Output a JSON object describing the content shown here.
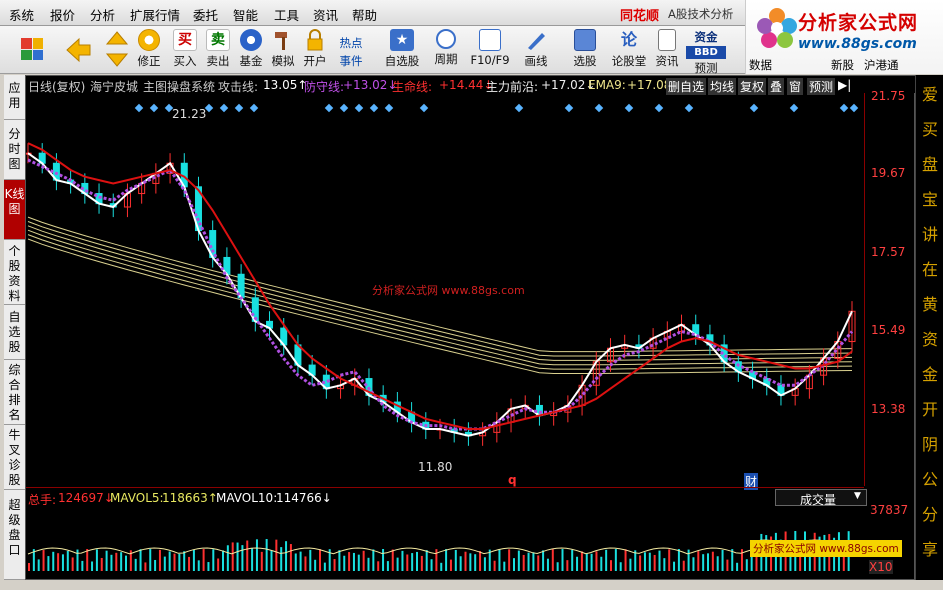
{
  "menu": {
    "items": [
      "系统",
      "报价",
      "分析",
      "扩展行情",
      "委托",
      "智能",
      "工具",
      "资讯",
      "帮助"
    ],
    "brand": "同花顺",
    "brand_tail": "A股技术分析"
  },
  "toolbar": {
    "buttons": [
      {
        "label": "修正",
        "icon": "refresh-icon"
      },
      {
        "label": "买入",
        "glyph": "买",
        "color": "#cc0000"
      },
      {
        "label": "卖出",
        "glyph": "卖",
        "color": "#007700"
      },
      {
        "label": "基金",
        "icon": "fund-icon"
      },
      {
        "label": "模拟",
        "icon": "hammer-icon"
      },
      {
        "label": "开户",
        "icon": "lock-icon"
      },
      {
        "label": "事件",
        "top": "热点"
      },
      {
        "label": "自选股",
        "icon": "star-icon"
      },
      {
        "label": "周期",
        "icon": "clock-icon"
      },
      {
        "label": "F10/F9",
        "icon": "f10-icon"
      },
      {
        "label": "画线",
        "icon": "pen-icon"
      },
      {
        "label": "选股",
        "icon": "select-icon"
      },
      {
        "label": "论股堂",
        "glyph": "论"
      },
      {
        "label": "资讯",
        "icon": "news-icon"
      },
      {
        "label": "预测",
        "top": "资金",
        "mid": "BBD"
      },
      {
        "label": "数据"
      },
      {
        "label": "新股"
      },
      {
        "label": "沪港通"
      }
    ]
  },
  "logo": {
    "title": "分析家公式网",
    "url": "www.88gs.com"
  },
  "sidebar": {
    "items": [
      "应用",
      "分时图",
      "K线图",
      "个股资料",
      "自选股",
      "综合排名",
      "牛叉诊股",
      "超级盘口"
    ],
    "active": 2
  },
  "info": {
    "period": "日线(复权)",
    "stock": "海宁皮城",
    "system": "主图操盘系统",
    "attack_label": "攻击线:",
    "attack": "13.05↑",
    "defend_label": "防守线:",
    "defend": "+13.02↓",
    "life_label": "生命线:",
    "life": "+14.44↓",
    "front_label": "主力前沿:",
    "front": "+17.02↓",
    "ema_label": "EMA9:",
    "ema": "+17.08",
    "buttons": [
      "删自选",
      "均线",
      "复权",
      "叠",
      "窗",
      "预测"
    ]
  },
  "chart_data": {
    "type": "line",
    "ylim": [
      11.0,
      22.0
    ],
    "yticks": [
      "21.75",
      "19.67",
      "17.57",
      "15.49",
      "13.38"
    ],
    "hi_label": "21.23",
    "lo_label": "11.80",
    "watermark": "分析家公式网 www.88gs.com",
    "markers": [
      "q",
      "财"
    ],
    "series": [
      {
        "color": "#ffffff",
        "values": [
          20.3,
          20.0,
          19.5,
          19.4,
          19.1,
          18.8,
          18.7,
          19.1,
          19.4,
          19.7,
          20.0,
          19.3,
          18.0,
          17.2,
          16.7,
          16.0,
          15.3,
          15.1,
          14.6,
          14.0,
          13.7,
          13.3,
          13.4,
          13.6,
          13.1,
          12.9,
          12.6,
          12.3,
          12.1,
          12.1,
          12.0,
          11.9,
          12.0,
          12.3,
          12.7,
          12.8,
          12.5,
          12.6,
          12.8,
          13.4,
          14.1,
          14.5,
          14.6,
          14.5,
          14.8,
          15.0,
          15.2,
          14.9,
          14.6,
          14.1,
          13.8,
          13.6,
          13.4,
          13.1,
          13.3,
          13.7,
          14.2,
          14.7,
          15.6
        ]
      },
      {
        "color": "#b050e0",
        "values": [
          20.1,
          19.9,
          19.7,
          19.5,
          19.2,
          19.0,
          18.9,
          19.2,
          19.4,
          19.6,
          19.8,
          19.2,
          18.3,
          17.4,
          16.6,
          16.0,
          15.4,
          14.8,
          14.2,
          13.7,
          13.4,
          13.5,
          13.7,
          13.8,
          13.3,
          12.8,
          12.5,
          12.3,
          12.2,
          12.2,
          12.1,
          12.1,
          12.1,
          12.3,
          12.5,
          12.7,
          12.6,
          12.6,
          12.7,
          13.1,
          13.6,
          14.0,
          14.3,
          14.4,
          14.6,
          14.8,
          15.0,
          14.9,
          14.7,
          14.3,
          14.0,
          13.8,
          13.6,
          13.4,
          13.4,
          13.7,
          14.0,
          14.5,
          15.0
        ]
      },
      {
        "color": "#dd1111",
        "values": [
          20.6,
          20.4,
          20.1,
          19.8,
          19.6,
          19.5,
          19.4,
          19.5,
          19.6,
          19.7,
          19.8,
          19.6,
          19.2,
          18.6,
          17.9,
          17.2,
          16.5,
          15.8,
          15.2,
          14.6,
          14.2,
          13.9,
          13.6,
          13.4,
          13.2,
          13.0,
          12.8,
          12.6,
          12.4,
          12.3,
          12.2,
          12.1,
          12.1,
          12.2,
          12.3,
          12.4,
          12.5,
          12.6,
          12.7,
          12.8,
          13.0,
          13.3,
          13.6,
          13.9,
          14.2,
          14.5,
          14.7,
          14.8,
          14.7,
          14.5,
          14.3,
          14.2,
          14.1,
          14.0,
          13.9,
          13.9,
          14.0,
          14.1,
          14.4
        ]
      }
    ]
  },
  "volume": {
    "total_label": "总手:",
    "total": "124697↓",
    "mavol5_label": "MAVOL5:",
    "mavol5": "118663↑",
    "mavol10_label": "MAVOL10:",
    "mavol10": "114766↓",
    "selector": "成交量",
    "top_tick": "37837",
    "unit": "X10",
    "badge": "分析家公式网 www.88gs.com"
  },
  "rightpanel": {
    "chars": [
      "爱",
      "买",
      "盘",
      "宝",
      "讲",
      "在",
      "黄",
      "资",
      "金",
      "开",
      "阴",
      "公",
      "分",
      "享"
    ]
  }
}
